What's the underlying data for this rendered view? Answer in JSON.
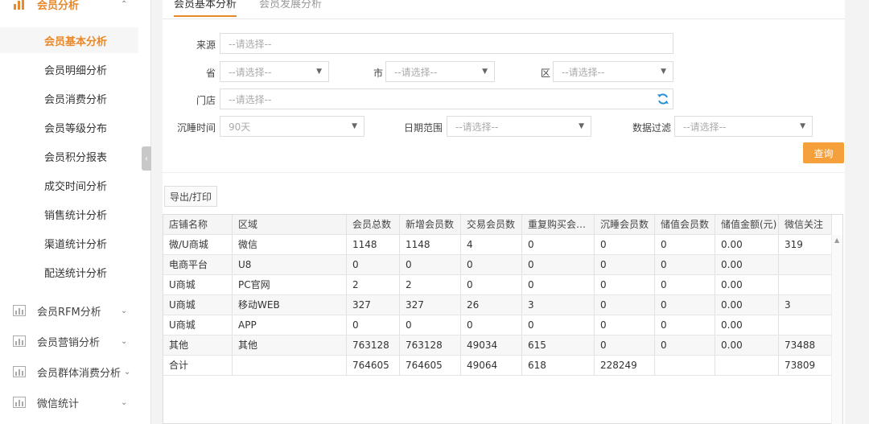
{
  "sidebar": {
    "groups": [
      {
        "label": "会员分析",
        "chevron": "⌃",
        "icon": "bar-chart-icon",
        "active": true
      },
      {
        "label": "会员RFM分析",
        "chevron": "⌄",
        "icon": "report-icon"
      },
      {
        "label": "会员营销分析",
        "chevron": "⌄",
        "icon": "report-icon"
      },
      {
        "label": "会员群体消费分析",
        "chevron": "⌄",
        "icon": "report-icon"
      },
      {
        "label": "微信统计",
        "chevron": "⌄",
        "icon": "report-icon"
      }
    ],
    "items": [
      {
        "label": "会员基本分析",
        "active": true
      },
      {
        "label": "会员明细分析"
      },
      {
        "label": "会员消费分析"
      },
      {
        "label": "会员等级分布"
      },
      {
        "label": "会员积分报表"
      },
      {
        "label": "成交时间分析"
      },
      {
        "label": "销售统计分析"
      },
      {
        "label": "渠道统计分析"
      },
      {
        "label": "配送统计分析"
      }
    ],
    "collapse_glyph": "‹"
  },
  "tabs": [
    {
      "label": "会员基本分析",
      "active": true
    },
    {
      "label": "会员发展分析"
    }
  ],
  "filters": {
    "source": {
      "label": "来源",
      "value": "--请选择--"
    },
    "province": {
      "label": "省",
      "value": "--请选择--"
    },
    "city": {
      "label": "市",
      "value": "--请选择--"
    },
    "district": {
      "label": "区",
      "value": "--请选择--"
    },
    "store": {
      "label": "门店",
      "value": "--请选择--"
    },
    "dormant": {
      "label": "沉睡时间",
      "value": "90天"
    },
    "date_range": {
      "label": "日期范围",
      "value": "--请选择--"
    },
    "data_filter": {
      "label": "数据过滤",
      "value": "--请选择--"
    },
    "caret": "▼"
  },
  "buttons": {
    "query": "查询",
    "export": "导出/打印"
  },
  "table": {
    "columns": [
      "店铺名称",
      "区域",
      "会员总数",
      "新增会员数",
      "交易会员数",
      "重复购买会员...",
      "沉睡会员数",
      "储值会员数",
      "储值金额(元)",
      "微信关注"
    ],
    "rows": [
      [
        "微/U商城",
        "微信",
        "1148",
        "1148",
        "4",
        "0",
        "0",
        "0",
        "0.00",
        "319"
      ],
      [
        "电商平台",
        "U8",
        "0",
        "0",
        "0",
        "0",
        "0",
        "0",
        "0.00",
        ""
      ],
      [
        "U商城",
        "PC官网",
        "2",
        "2",
        "0",
        "0",
        "0",
        "0",
        "0.00",
        ""
      ],
      [
        "U商城",
        "移动WEB",
        "327",
        "327",
        "26",
        "3",
        "0",
        "0",
        "0.00",
        "3"
      ],
      [
        "U商城",
        "APP",
        "0",
        "0",
        "0",
        "0",
        "0",
        "0",
        "0.00",
        ""
      ],
      [
        "其他",
        "其他",
        "763128",
        "763128",
        "49034",
        "615",
        "0",
        "0",
        "0.00",
        "73488"
      ],
      [
        "合计",
        "",
        "764605",
        "764605",
        "49064",
        "618",
        "228249",
        "",
        "",
        "73809"
      ]
    ],
    "scroll_up_glyph": "▲"
  }
}
